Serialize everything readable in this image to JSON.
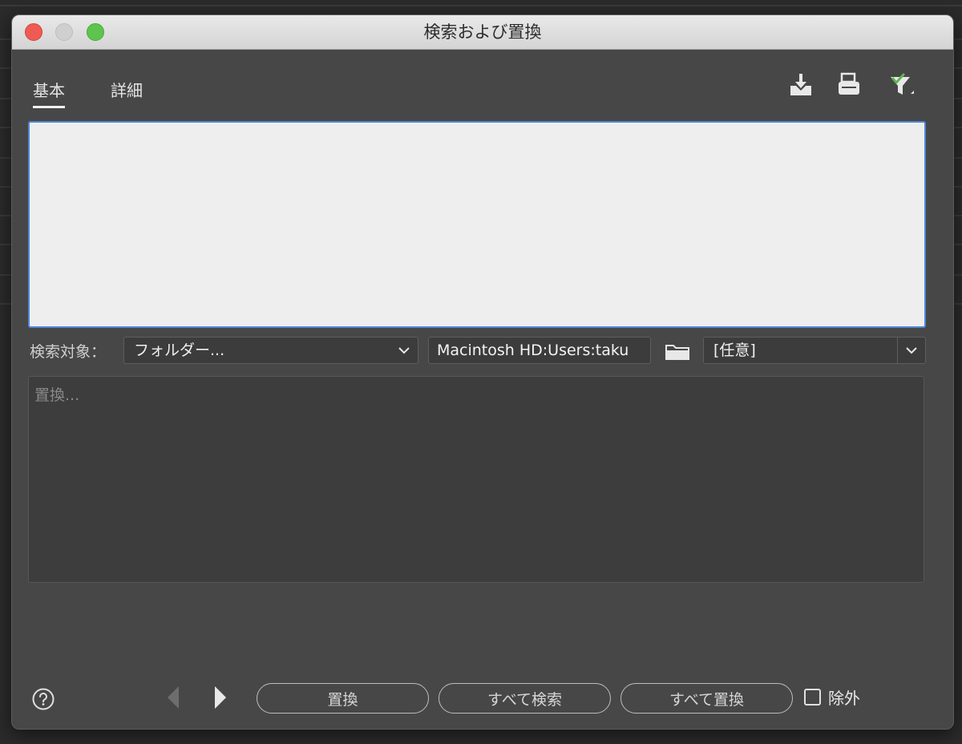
{
  "window": {
    "title": "検索および置換"
  },
  "tabs": [
    {
      "label": "基本",
      "active": true
    },
    {
      "label": "詳細",
      "active": false
    }
  ],
  "toolbar": {
    "icons": [
      "save-query-icon",
      "print-icon",
      "filter-check-icon"
    ],
    "accent_check_color": "#5db84b"
  },
  "search": {
    "value": ""
  },
  "target": {
    "label": "検索対象：",
    "scope_selected": "フォルダー...",
    "path_value": "Macintosh HD:Users:taku",
    "file_type_selected": "[任意]"
  },
  "replace": {
    "placeholder": "置換..."
  },
  "footer": {
    "replace_label": "置換",
    "find_all_label": "すべて検索",
    "replace_all_label": "すべて置換",
    "exclude_label": "除外",
    "exclude_checked": false
  },
  "colors": {
    "window_bg": "#474747",
    "focus_ring": "#4d88d8",
    "traffic_close": "#ee5b52",
    "traffic_min": "#cfcfcf",
    "traffic_max": "#5dc54d"
  }
}
